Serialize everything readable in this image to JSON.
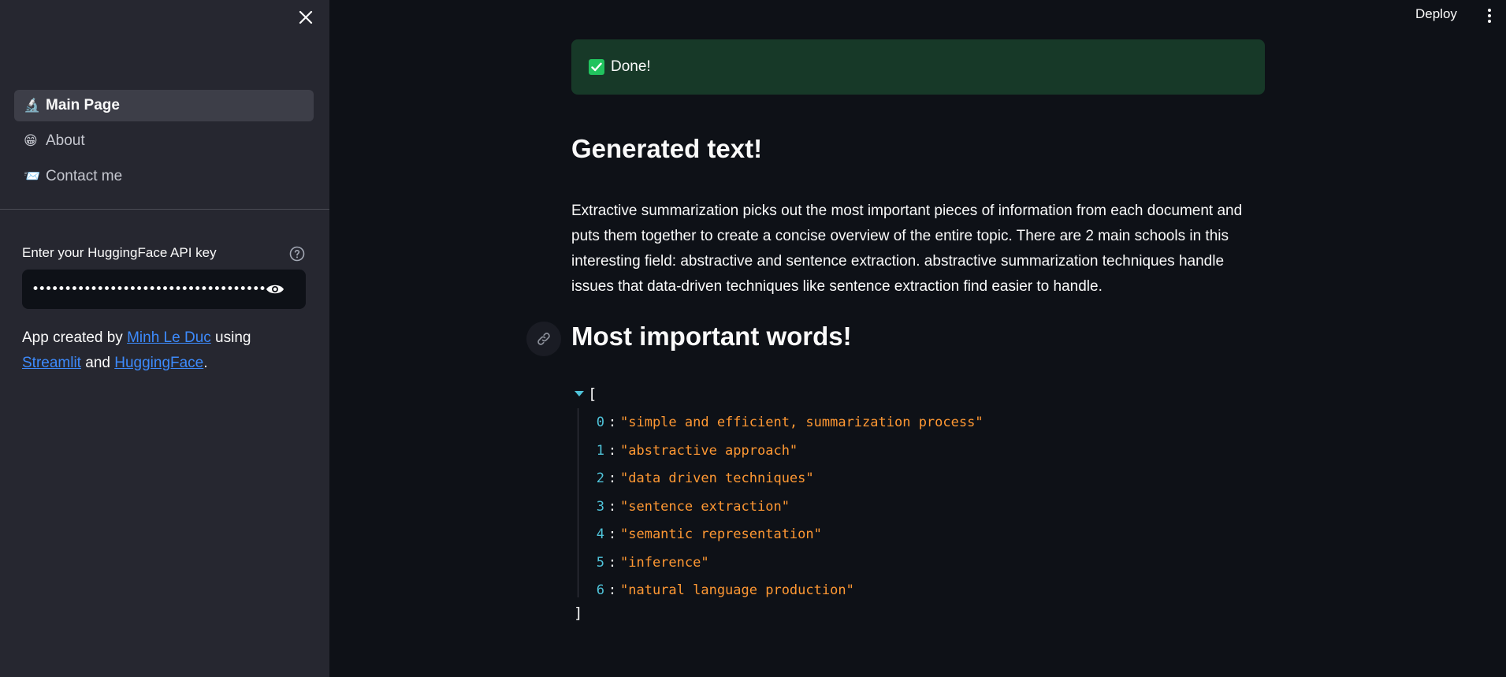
{
  "sidebar": {
    "nav": [
      {
        "emoji": "🔬",
        "label": "Main Page",
        "active": true
      },
      {
        "emoji": "😁",
        "label": "About",
        "active": false
      },
      {
        "emoji": "📨",
        "label": "Contact me",
        "active": false
      }
    ],
    "api_key_label": "Enter your HuggingFace API key",
    "api_key_value": "••••••••••••••••••••••••••••••••••••••",
    "credits": {
      "prefix": "App created by",
      "author": "Minh Le Duc",
      "mid": "using",
      "tool1": "Streamlit",
      "and": "and",
      "tool2": "HuggingFace",
      "end": "."
    }
  },
  "header": {
    "deploy_label": "Deploy"
  },
  "main": {
    "success_text": "Done!",
    "generated_title": "Generated text!",
    "generated_paragraph": "Extractive summarization picks out the most important pieces of information from each document and puts them together to create a concise overview of the entire topic. There are 2 main schools in this interesting field: abstractive and sentence extraction. abstractive summarization techniques handle issues that data-driven techniques like sentence extraction find easier to handle.",
    "words_title": "Most important words!",
    "json_open": "[",
    "json_close": "]",
    "words": [
      {
        "index": "0",
        "value": "\"simple and efficient, summarization process\""
      },
      {
        "index": "1",
        "value": "\"abstractive approach\""
      },
      {
        "index": "2",
        "value": "\"data driven techniques\""
      },
      {
        "index": "3",
        "value": "\"sentence extraction\""
      },
      {
        "index": "4",
        "value": "\"semantic representation\""
      },
      {
        "index": "5",
        "value": "\"inference\""
      },
      {
        "index": "6",
        "value": "\"natural language production\""
      }
    ]
  },
  "colors": {
    "sidebar_bg": "#262730",
    "main_bg": "#0e1117",
    "success_bg": "#173928",
    "link": "#3d8bfd",
    "json_index": "#4fc3d9",
    "json_string": "#ff9833"
  }
}
